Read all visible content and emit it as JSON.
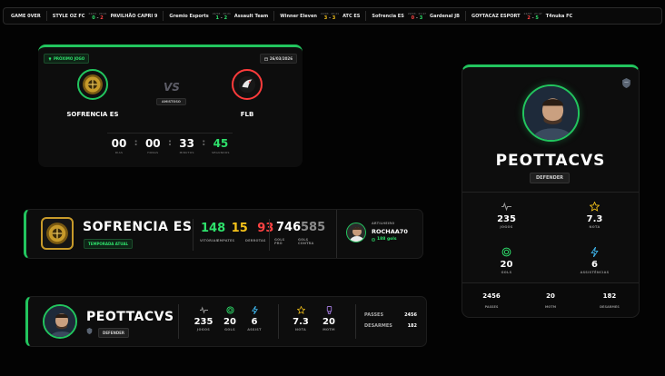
{
  "ticker": [
    {
      "home": "GAME 0VER",
      "date": "",
      "score_home": "",
      "score_away": "",
      "away": ""
    },
    {
      "home": "STYLE OZ FC",
      "date": "22/03 · 20:21",
      "score_home": "0",
      "score_away": "2",
      "away": "PAVILHÃO CAPRI 9"
    },
    {
      "home": "Gremio Esports",
      "date": "22/03 · 20:21",
      "score_home": "1",
      "score_away": "2",
      "away": "Assault Team"
    },
    {
      "home": "Winner Eleven",
      "date": "22/03 · 20:21",
      "score_home": "3",
      "score_away": "3",
      "away": "ATC ES"
    },
    {
      "home": "Sofrencia ES",
      "date": "22/03 · 21:47",
      "score_home": "0",
      "score_away": "3",
      "away": "Gardenal JB"
    },
    {
      "home": "GOYTACAZ ESPORT",
      "date": "22/03 · 21:47",
      "score_home": "2",
      "score_away": "5",
      "away": "T4nuka FC"
    }
  ],
  "next_match": {
    "label": "PRÓXIMO JOGO",
    "date": "26/03/2026",
    "home": "SOFRENCIA ES",
    "away": "FLB",
    "vs": "VS",
    "round": "AMISTOSO",
    "countdown": {
      "days": "00",
      "days_label": "DIAS",
      "hours": "00",
      "hours_label": "HORAS",
      "minutes": "33",
      "minutes_label": "MINUTOS",
      "seconds": "45",
      "seconds_label": "SEGUNDOS"
    }
  },
  "team": {
    "name": "SOFRENCIA ES",
    "season": "TEMPORADA ATUAL",
    "wins": "148",
    "draws": "15",
    "losses": "93",
    "wins_label": "VITÓRIAS",
    "draws_label": "EMPATES",
    "losses_label": "DERROTAS",
    "goals_for": "746",
    "goals_against": "585",
    "goals_for_label": "GOLS PRÓ",
    "goals_against_label": "GOLS CONTRA",
    "scorer_label": "ARTILHEIRO",
    "scorer_name": "ROCHAA70",
    "scorer_goals": "188 gols"
  },
  "player": {
    "name": "PEOTTACVS",
    "role": "DEFENDER",
    "games": "235",
    "games_label": "JOGOS",
    "goals": "20",
    "goals_label": "GOLS",
    "assists": "6",
    "assists_label": "ASSIST",
    "rating": "7.3",
    "rating_label": "NOTA",
    "motm": "20",
    "motm_label": "MOTM",
    "passes_label": "PASSES",
    "passes": "2456",
    "tackles_label": "DESARMES",
    "tackles": "182"
  },
  "profile": {
    "name": "PEOTTACVS",
    "role": "DEFENDER",
    "games": "235",
    "games_label": "JOGOS",
    "rating": "7.3",
    "rating_label": "NOTA",
    "goals": "20",
    "goals_label": "GOLS",
    "assists": "6",
    "assists_label": "ASSISTÊNCIAS",
    "passes": "2456",
    "passes_label": "PASSES",
    "motm": "20",
    "motm_label": "MOTM",
    "tackles": "182",
    "tackles_label": "DESARMES"
  },
  "colors": {
    "accent": "#22c55e",
    "win": "#2ee06b",
    "draw": "#f3c11a",
    "loss": "#ff4343",
    "background": "#030303",
    "card": "#0d0d0d"
  },
  "icons": [
    "trophy-icon",
    "calendar-icon",
    "activity-icon",
    "target-icon",
    "lightning-icon",
    "star-icon",
    "medal-icon",
    "shirt-icon",
    "club-crest-icon"
  ]
}
